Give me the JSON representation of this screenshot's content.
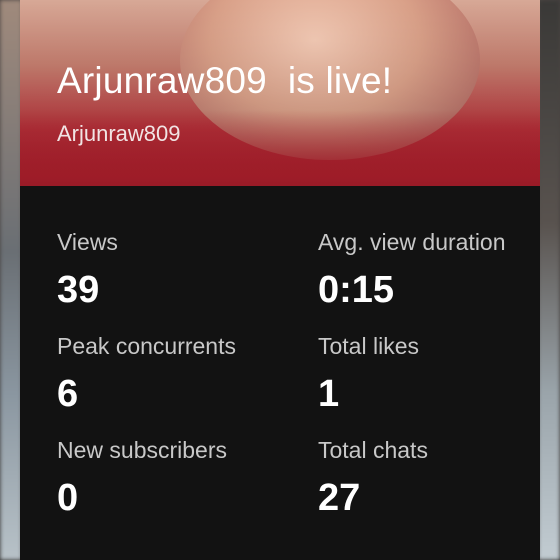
{
  "live": {
    "title": "Arjunraw809  is live!",
    "channel_name": "Arjunraw809"
  },
  "stats": [
    {
      "label": "Views",
      "value": "39"
    },
    {
      "label": "Avg. view duration",
      "value": "0:15"
    },
    {
      "label": "Peak concurrents",
      "value": "6"
    },
    {
      "label": "Total likes",
      "value": "1"
    },
    {
      "label": "New subscribers",
      "value": "0"
    },
    {
      "label": "Total chats",
      "value": "27"
    }
  ],
  "colors": {
    "card_background": "#121212",
    "hero_red": "#b2202d",
    "label_text": "#c8c8c8",
    "value_text": "#ffffff"
  }
}
